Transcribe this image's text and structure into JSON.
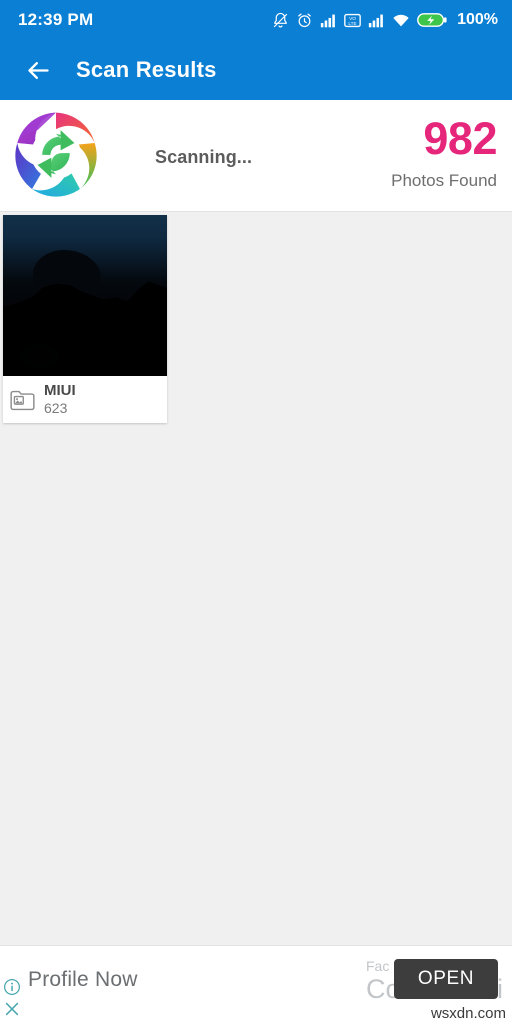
{
  "statusbar": {
    "time": "12:39 PM",
    "battery_percent": "100%",
    "icons": [
      "bell-muted-icon",
      "alarm-clock-icon",
      "signal-bars-icon",
      "volte-icon",
      "signal-bars-icon",
      "wifi-icon",
      "battery-charging-icon"
    ]
  },
  "appbar": {
    "title": "Scan Results",
    "back_label": "back-arrow"
  },
  "scan_header": {
    "status_text": "Scanning...",
    "count": "982",
    "count_label": "Photos Found",
    "count_color": "#e6267a",
    "logo_name": "app-logo-recovery-swirl"
  },
  "albums": [
    {
      "name": "MIUI",
      "count": "623",
      "icon": "photo-folder-icon"
    }
  ],
  "ad": {
    "headline": "Profile Now",
    "sub_small": "Fac",
    "sub_big": "Co",
    "sub_tail": "i",
    "open_label": "OPEN",
    "info_icon": "info-circle-icon",
    "close_icon": "close-x-icon",
    "watermark": "wsxdn.com"
  },
  "colors": {
    "accent_blue": "#0b7fd4",
    "accent_pink": "#e6267a",
    "background": "#f0f0f0",
    "ad_teal": "#3fa9b0"
  }
}
